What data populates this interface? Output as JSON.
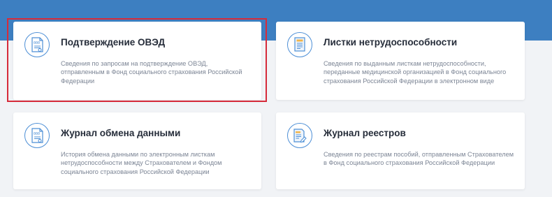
{
  "colors": {
    "header_band": "#3d7fc1",
    "page_background": "#f1f3f6",
    "card_background": "#ffffff",
    "title_text": "#262d3a",
    "description_text": "#7c8595",
    "icon_accent": "#4d8fd6",
    "highlight_border": "#d62b3a"
  },
  "cards": [
    {
      "icon": "document-seal-icon",
      "title": "Подтверждение ОВЭД",
      "description": "Сведения по запросам на подтверждение ОВЭД, отправленным в Фонд социального страхования Российской Федерации",
      "highlighted": true
    },
    {
      "icon": "sick-leave-document-icon",
      "title": "Листки нетрудоспособности",
      "description": "Сведения по выданным листкам нетрудоспособности, переданные медицинской организацией в Фонд социального страхования Российской Федерации в электронном виде",
      "highlighted": false
    },
    {
      "icon": "document-seal-icon",
      "title": "Журнал обмена данными",
      "description": "История обмена данными по электронным листкам нетрудоспособности между Страхователем и Фондом социального страхования Российской Федерации",
      "highlighted": false
    },
    {
      "icon": "registry-edit-icon",
      "title": "Журнал реестров",
      "description": "Сведения по реестрам пособий, отправленным Страхователем в Фонд социального страхования Российской Федерации",
      "highlighted": false
    }
  ]
}
